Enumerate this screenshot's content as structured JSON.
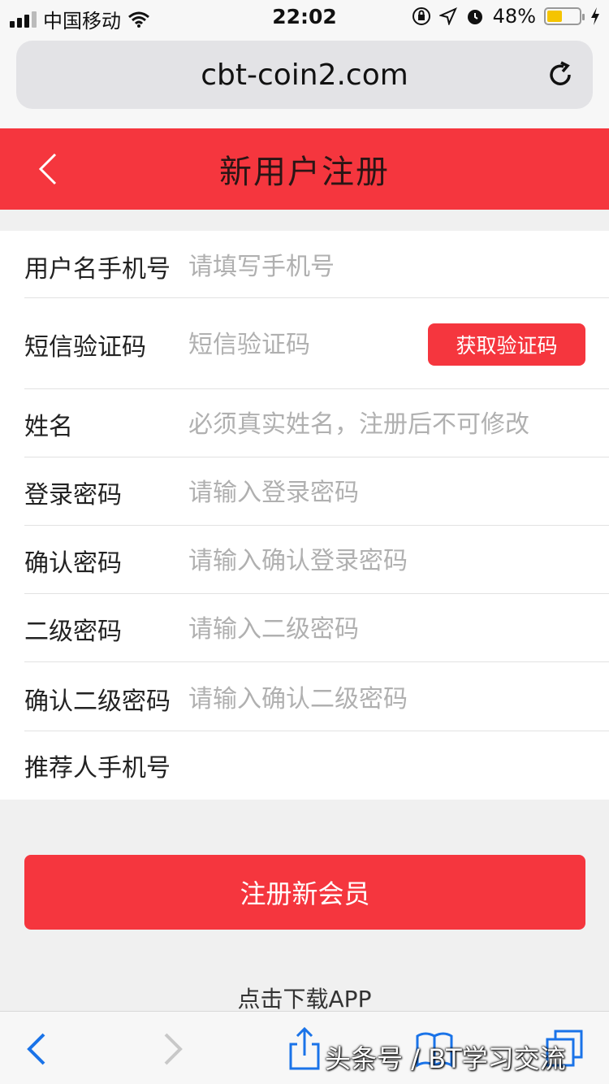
{
  "status_bar": {
    "carrier": "中国移动",
    "time": "22:02",
    "battery_percent": "48%",
    "battery_level": 0.48
  },
  "browser": {
    "url": "cbt-coin2.com"
  },
  "header": {
    "title": "新用户注册"
  },
  "form": {
    "fields": [
      {
        "label": "用户名手机号",
        "placeholder": "请填写手机号"
      },
      {
        "label": "短信验证码",
        "placeholder": "短信验证码"
      },
      {
        "label": "姓名",
        "placeholder": "必须真实姓名，注册后不可修改"
      },
      {
        "label": "登录密码",
        "placeholder": "请输入登录密码"
      },
      {
        "label": "确认密码",
        "placeholder": "请输入确认登录密码"
      },
      {
        "label": "二级密码",
        "placeholder": "请输入二级密码"
      },
      {
        "label": "确认二级密码",
        "placeholder": "请输入确认二级密码"
      },
      {
        "label": "推荐人手机号",
        "placeholder": ""
      }
    ],
    "sms_button": "获取验证码",
    "submit_button": "注册新会员",
    "download_link": "点击下载APP"
  },
  "watermark": "头条号 / BT学习交流",
  "colors": {
    "accent": "#f5363e",
    "page_bg": "#f0f0f0"
  }
}
